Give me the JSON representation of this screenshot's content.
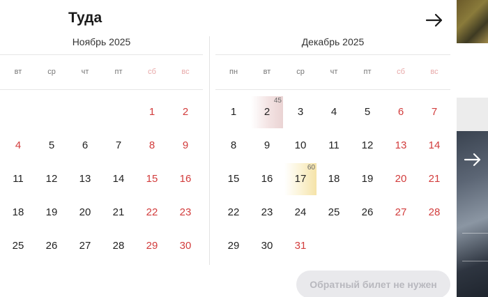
{
  "title": "Туда",
  "november": {
    "title": "Ноябрь 2025",
    "weekdays": [
      "вт",
      "ср",
      "чт",
      "пт",
      "сб",
      "вс"
    ],
    "days": [
      {
        "d": "1",
        "we": true,
        "col": 4,
        "row": 0
      },
      {
        "d": "2",
        "we": true,
        "col": 5,
        "row": 0
      },
      {
        "d": "4",
        "we": true,
        "col": 0,
        "row": 1
      },
      {
        "d": "5",
        "col": 1,
        "row": 1
      },
      {
        "d": "6",
        "col": 2,
        "row": 1
      },
      {
        "d": "7",
        "col": 3,
        "row": 1
      },
      {
        "d": "8",
        "we": true,
        "col": 4,
        "row": 1
      },
      {
        "d": "9",
        "we": true,
        "col": 5,
        "row": 1
      },
      {
        "d": "11",
        "col": 0,
        "row": 2
      },
      {
        "d": "12",
        "col": 1,
        "row": 2
      },
      {
        "d": "13",
        "col": 2,
        "row": 2
      },
      {
        "d": "14",
        "col": 3,
        "row": 2
      },
      {
        "d": "15",
        "we": true,
        "col": 4,
        "row": 2
      },
      {
        "d": "16",
        "we": true,
        "col": 5,
        "row": 2
      },
      {
        "d": "18",
        "col": 0,
        "row": 3
      },
      {
        "d": "19",
        "col": 1,
        "row": 3
      },
      {
        "d": "20",
        "col": 2,
        "row": 3
      },
      {
        "d": "21",
        "col": 3,
        "row": 3
      },
      {
        "d": "22",
        "we": true,
        "col": 4,
        "row": 3
      },
      {
        "d": "23",
        "we": true,
        "col": 5,
        "row": 3
      },
      {
        "d": "25",
        "col": 0,
        "row": 4
      },
      {
        "d": "26",
        "col": 1,
        "row": 4
      },
      {
        "d": "27",
        "col": 2,
        "row": 4
      },
      {
        "d": "28",
        "col": 3,
        "row": 4
      },
      {
        "d": "29",
        "we": true,
        "col": 4,
        "row": 4
      },
      {
        "d": "30",
        "we": true,
        "col": 5,
        "row": 4
      }
    ]
  },
  "december": {
    "title": "Декабрь 2025",
    "weekdays": [
      "пн",
      "вт",
      "ср",
      "чт",
      "пт",
      "сб",
      "вс"
    ],
    "days": [
      {
        "d": "1",
        "col": 0,
        "row": 0
      },
      {
        "d": "2",
        "col": 1,
        "row": 0,
        "price": "45",
        "hl": "red"
      },
      {
        "d": "3",
        "col": 2,
        "row": 0
      },
      {
        "d": "4",
        "col": 3,
        "row": 0
      },
      {
        "d": "5",
        "col": 4,
        "row": 0
      },
      {
        "d": "6",
        "we": true,
        "col": 5,
        "row": 0
      },
      {
        "d": "7",
        "we": true,
        "col": 6,
        "row": 0
      },
      {
        "d": "8",
        "col": 0,
        "row": 1
      },
      {
        "d": "9",
        "col": 1,
        "row": 1
      },
      {
        "d": "10",
        "col": 2,
        "row": 1
      },
      {
        "d": "11",
        "col": 3,
        "row": 1
      },
      {
        "d": "12",
        "col": 4,
        "row": 1
      },
      {
        "d": "13",
        "we": true,
        "col": 5,
        "row": 1
      },
      {
        "d": "14",
        "we": true,
        "col": 6,
        "row": 1
      },
      {
        "d": "15",
        "col": 0,
        "row": 2
      },
      {
        "d": "16",
        "col": 1,
        "row": 2
      },
      {
        "d": "17",
        "col": 2,
        "row": 2,
        "price": "60",
        "hl": "yellow"
      },
      {
        "d": "18",
        "col": 3,
        "row": 2
      },
      {
        "d": "19",
        "col": 4,
        "row": 2
      },
      {
        "d": "20",
        "we": true,
        "col": 5,
        "row": 2
      },
      {
        "d": "21",
        "we": true,
        "col": 6,
        "row": 2
      },
      {
        "d": "22",
        "col": 0,
        "row": 3
      },
      {
        "d": "23",
        "col": 1,
        "row": 3
      },
      {
        "d": "24",
        "col": 2,
        "row": 3
      },
      {
        "d": "25",
        "col": 3,
        "row": 3
      },
      {
        "d": "26",
        "col": 4,
        "row": 3
      },
      {
        "d": "27",
        "we": true,
        "col": 5,
        "row": 3
      },
      {
        "d": "28",
        "we": true,
        "col": 6,
        "row": 3
      },
      {
        "d": "29",
        "col": 0,
        "row": 4
      },
      {
        "d": "30",
        "col": 1,
        "row": 4
      },
      {
        "d": "31",
        "we": true,
        "col": 2,
        "row": 4
      }
    ]
  },
  "oneway_button": "Обратный билет не нужен",
  "colors": {
    "weekend": "#d23c3c",
    "weekday_header_weekend": "#e8a8a8",
    "accent": "#1a1a1a"
  },
  "icons": {
    "next": "arrow-right-icon",
    "bg_next": "arrow-right-icon"
  }
}
